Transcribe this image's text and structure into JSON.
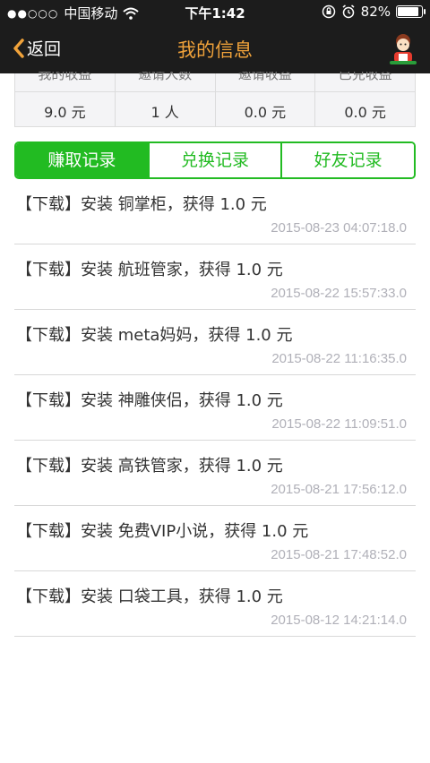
{
  "status": {
    "carrier": "中国移动",
    "signal": "●●○○○",
    "time": "下午1:42",
    "battery_text": "82%",
    "battery_level": 0.82
  },
  "nav": {
    "back_label": "返回",
    "title": "我的信息"
  },
  "stats": {
    "columns": [
      {
        "label": "我的收益",
        "value": "9.0 元"
      },
      {
        "label": "邀请人数",
        "value": "1 人"
      },
      {
        "label": "邀请收益",
        "value": "0.0 元"
      },
      {
        "label": "已兑收益",
        "value": "0.0 元"
      }
    ]
  },
  "tabs": [
    {
      "label": "赚取记录",
      "active": true
    },
    {
      "label": "兑换记录",
      "active": false
    },
    {
      "label": "好友记录",
      "active": false
    }
  ],
  "records": [
    {
      "text": "【下载】安装 铜掌柜，获得 1.0 元",
      "time": "2015-08-23 04:07:18.0"
    },
    {
      "text": "【下载】安装 航班管家，获得 1.0 元",
      "time": "2015-08-22 15:57:33.0"
    },
    {
      "text": "【下载】安装 meta妈妈，获得 1.0 元",
      "time": "2015-08-22 11:16:35.0"
    },
    {
      "text": "【下载】安装 神雕侠侣，获得 1.0 元",
      "time": "2015-08-22 11:09:51.0"
    },
    {
      "text": "【下载】安装 高铁管家，获得 1.0 元",
      "time": "2015-08-21 17:56:12.0"
    },
    {
      "text": "【下载】安装 免费VIP小说，获得 1.0 元",
      "time": "2015-08-21 17:48:52.0"
    },
    {
      "text": "【下载】安装 口袋工具，获得 1.0 元",
      "time": "2015-08-12 14:21:14.0"
    }
  ],
  "colors": {
    "accent_green": "#22bb22",
    "title_orange": "#f0a23a",
    "bar_dark": "#1c1c1c"
  },
  "icons": [
    "wifi-icon",
    "rotation-lock-icon",
    "alarm-icon",
    "battery-icon",
    "back-chevron-icon",
    "avatar-icon"
  ]
}
